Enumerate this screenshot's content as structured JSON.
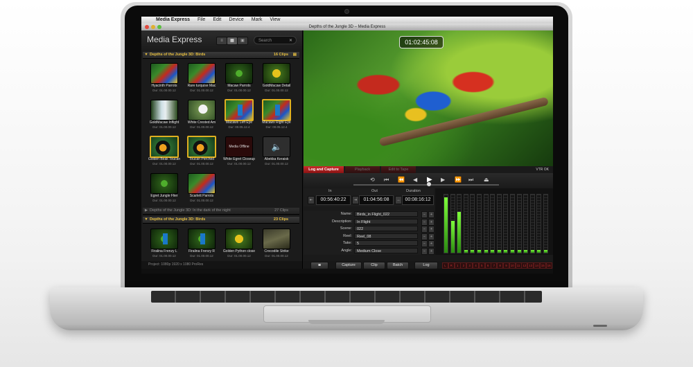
{
  "menubar": {
    "app": "Media Express",
    "items": [
      "File",
      "Edit",
      "Device",
      "Mark",
      "View"
    ]
  },
  "window_title": "Depths of the Jungle 3D – Media Express",
  "browser": {
    "title": "Media Express",
    "search_placeholder": "Search",
    "bins": [
      {
        "name": "Depths of the Jungle 3D: Birds",
        "count": "16 Clips",
        "clips": [
          {
            "name": "Hyacinth Parrots",
            "dur": "Dur: 01.00.00.12",
            "thumb": "parrot"
          },
          {
            "name": "Rare turquise Mac",
            "dur": "Dur: 01.00.00.12",
            "thumb": "parrot"
          },
          {
            "name": "Macaw Parrots",
            "dur": "Dur: 01.00.00.12",
            "thumb": "frog"
          },
          {
            "name": "GoldMacaw Detail",
            "dur": "Dur: 01.00.00.12",
            "thumb": "python"
          },
          {
            "name": "GoldMacaw Inflight",
            "dur": "Dur: 01.00.00.12",
            "thumb": "waterfall"
          },
          {
            "name": "White Crested Am",
            "dur": "Dur: 01.00.00.12",
            "thumb": "egret"
          },
          {
            "name": "Macaws Left Eye",
            "dur": "Dur: 00.05.12.4",
            "thumb": "parrot"
          },
          {
            "name": "Macaws Right Eye",
            "dur": "Dur: 00.05.12.4",
            "thumb": "parrot"
          },
          {
            "name": "Golden Beak Toucan",
            "dur": "Dur: 01.00.00.12",
            "thumb": "toucan"
          },
          {
            "name": "Toucan Perched",
            "dur": "Dur: 01.00.00.12",
            "thumb": "toucan"
          },
          {
            "name": "White Egret Closeup",
            "dur": "Dur: 01.00.00.12",
            "thumb": "offline",
            "label": "Media Offline"
          },
          {
            "name": "Abekka Keraisk",
            "dur": "Dur: 01.00.00.12",
            "thumb": "audio"
          },
          {
            "name": "Egret Jungle Flier",
            "dur": "Dur: 01.00.00.12",
            "thumb": "frog"
          },
          {
            "name": "Scarlett Parrots",
            "dur": "Dur: 01.00.00.12",
            "thumb": "parrot"
          }
        ]
      },
      {
        "name": "Depths of the Jungle 3D: In the dark of the night",
        "count": "27 Clips"
      },
      {
        "name": "Depths of the Jungle 3D: Birds",
        "count": "23 Clips",
        "clips": [
          {
            "name": "Firalina Frenzy L",
            "dur": "Dur: 01.00.00.12",
            "thumb": "frog"
          },
          {
            "name": "Firalina Frenzy R",
            "dur": "Dur: 01.00.00.12",
            "thumb": "frog"
          },
          {
            "name": "Golden Python close",
            "dur": "Dur: 01.00.00.12",
            "thumb": "python"
          },
          {
            "name": "Crocodile Strike",
            "dur": "Dur: 01.00.00.12",
            "thumb": "croc"
          }
        ]
      }
    ],
    "project": "Project: 1080p 1920 x 1080 ProRes"
  },
  "viewer": {
    "timecode": "01:02:45:08",
    "tabs": [
      "Log and Capture",
      "Playback",
      "Edit to Tape"
    ],
    "vtr_status": "VTR OK"
  },
  "timecodes": {
    "in_label": "In",
    "in": "00:56:40:22",
    "out_label": "Out",
    "out": "01:04:56:08",
    "duration_label": "Duration",
    "duration": "00:08:16:12"
  },
  "metadata": [
    {
      "label": "Name:",
      "value": "Birds_in Flight_022"
    },
    {
      "label": "Description:",
      "value": "In Flight"
    },
    {
      "label": "Scene:",
      "value": "022"
    },
    {
      "label": "Reel:",
      "value": "Reel_08"
    },
    {
      "label": "Take:",
      "value": "5"
    },
    {
      "label": "Angle:",
      "value": "Medium Close"
    }
  ],
  "actions": [
    "Capture",
    "Clip",
    "Batch",
    "Log"
  ],
  "channels": [
    "L",
    "R",
    "1",
    "2",
    "3",
    "4",
    "5",
    "6",
    "7",
    "8",
    "9",
    "10",
    "11",
    "12",
    "13",
    "14",
    "15",
    "16"
  ],
  "audio_levels": [
    0.95,
    0.55,
    0.7,
    0.05,
    0.05,
    0.05,
    0.05,
    0.05,
    0.05,
    0.05,
    0.05,
    0.05,
    0.05,
    0.05,
    0.05,
    0.05
  ]
}
